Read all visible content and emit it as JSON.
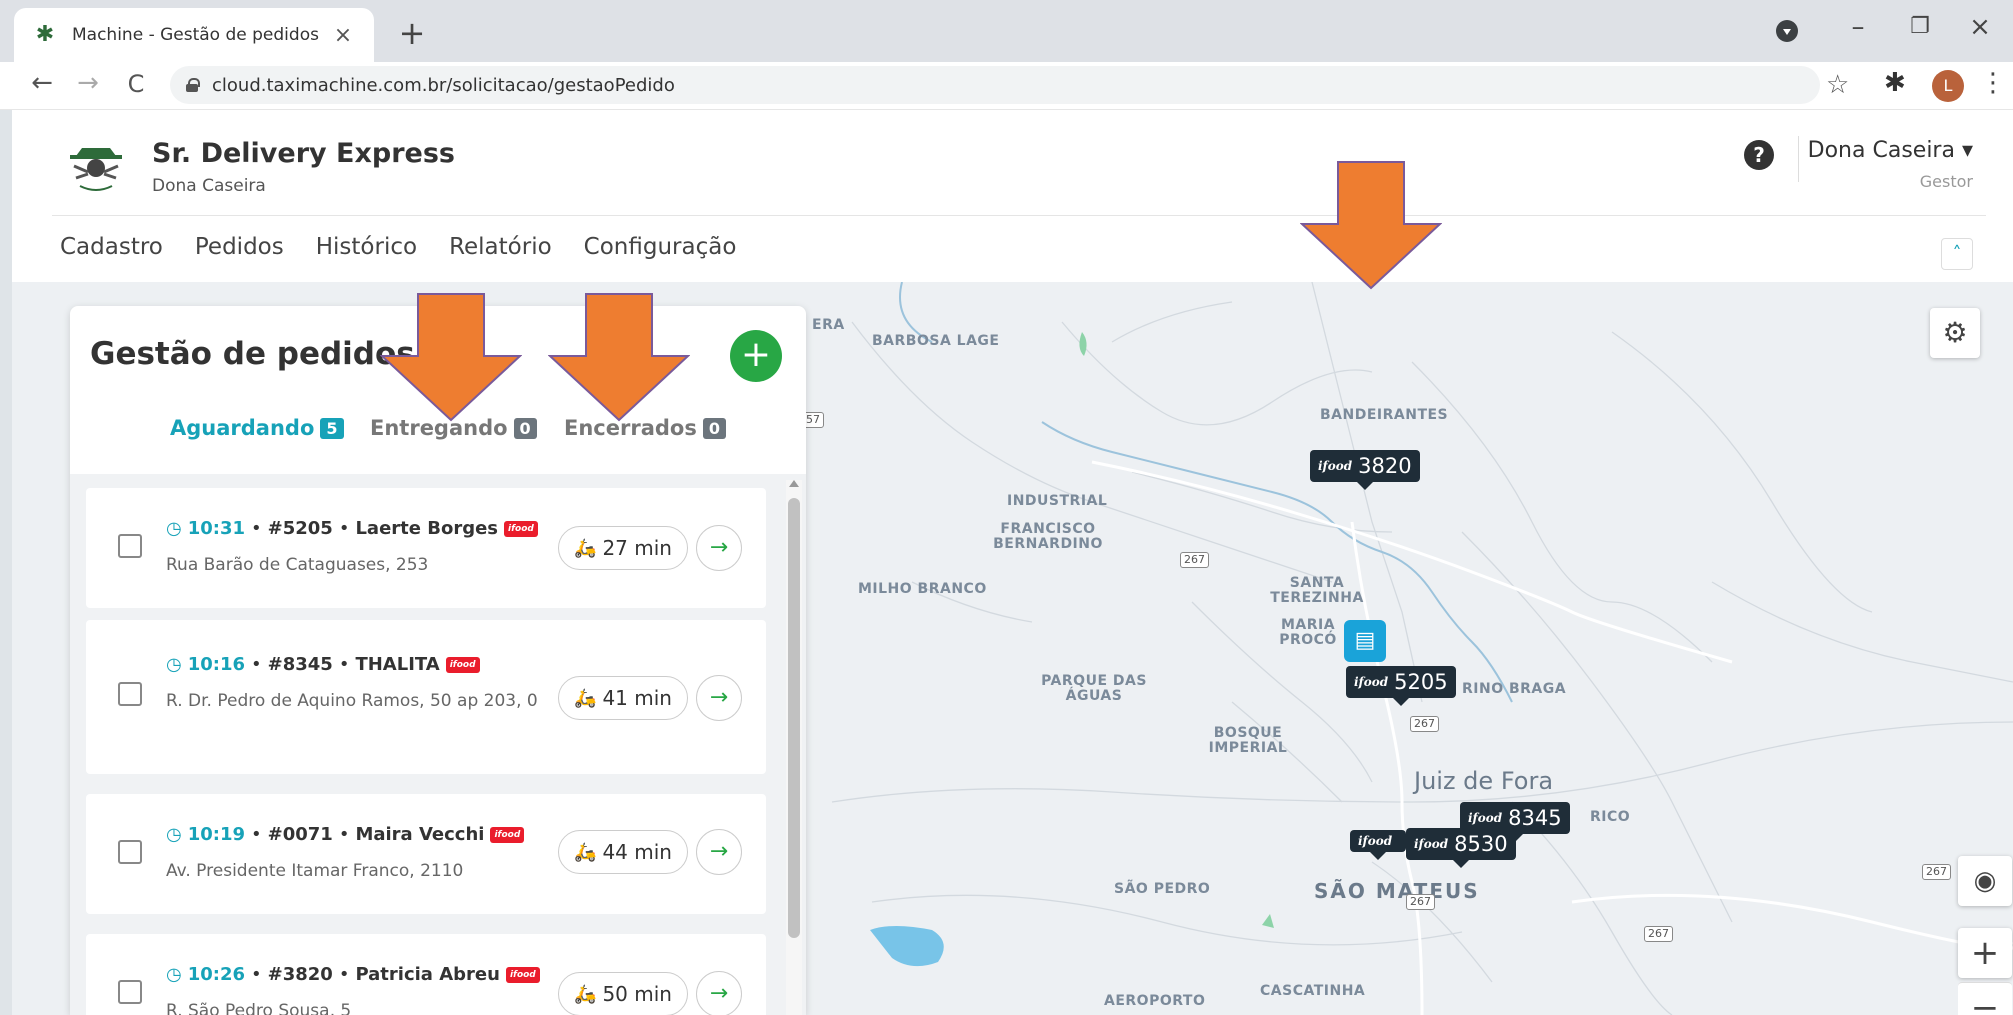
{
  "browser": {
    "tab_title": "Machine - Gestão de pedidos",
    "tab_close": "×",
    "new_tab": "+",
    "url": "cloud.taximachine.com.br/solicitacao/gestaoPedido",
    "profile_initial": "L",
    "back": "←",
    "forward": "→",
    "reload": "C",
    "star": "☆",
    "extensions": "✱",
    "menu": "⋮",
    "minimize": "–",
    "restore": "❐",
    "close": "×"
  },
  "header": {
    "brand_name": "Sr. Delivery Express",
    "brand_sub": "Dona Caseira",
    "help": "?",
    "user_name": "Dona Caseira ▾",
    "user_role": "Gestor",
    "collapse": "˄",
    "nav": [
      "Cadastro",
      "Pedidos",
      "Histórico",
      "Relatório",
      "Configuração"
    ]
  },
  "panel": {
    "title": "Gestão de pedidos",
    "add": "+",
    "tabs": [
      {
        "label": "Aguardando",
        "count": "5"
      },
      {
        "label": "Entregando",
        "count": "0"
      },
      {
        "label": "Encerrados",
        "count": "0"
      }
    ],
    "orders": [
      {
        "time": "10:31",
        "code": "#5205",
        "name": "Laerte Borges",
        "address": "Rua Barão de Cataguases, 253",
        "eta": "27 min"
      },
      {
        "time": "10:16",
        "code": "#8345",
        "name": "THALITA",
        "address": "R. Dr. Pedro de Aquino Ramos, 50 ap 203, 0",
        "eta": "41 min"
      },
      {
        "time": "10:19",
        "code": "#0071",
        "name": "Maira Vecchi",
        "address": "Av. Presidente Itamar Franco, 2110",
        "eta": "44 min"
      },
      {
        "time": "10:26",
        "code": "#3820",
        "name": "Patricia Abreu",
        "address": "R. São Pedro Sousa, 5",
        "eta": "50 min"
      }
    ],
    "sep": "•",
    "clock": "◷",
    "moto": "🛵",
    "go": "→",
    "ifood_badge": "ifood"
  },
  "map": {
    "labels": {
      "barbosa_lage": "BARBOSA LAGE",
      "bandeirantes": "BANDEIRANTES",
      "industrial": "INDUSTRIAL",
      "francisco_bernardino": "FRANCISCO BERNARDINO",
      "milho_branco": "MILHO BRANCO",
      "santa_terezinha": "SANTA TEREZINHA",
      "maria_proco": "MARIA PROCÓ",
      "parque_das_aguas": "PARQUE DAS ÁGUAS",
      "rino_braga": "RINO BRAGA",
      "bosque_imperial": "BOSQUE IMPERIAL",
      "juiz_de_fora": "Juiz de Fora",
      "rico": "RICO",
      "sao_pedro": "SÃO PEDRO",
      "sao_mateus": "SÃO MATEUS",
      "cascatinha": "CASCATINHA",
      "aeroporto": "AEROPORTO",
      "era": "ERA"
    },
    "road_shields": [
      "267",
      "267",
      "267",
      "267",
      "267",
      "57"
    ],
    "pins": [
      {
        "logo": "ifood",
        "number": "3820"
      },
      {
        "logo": "ifood",
        "number": "5205"
      },
      {
        "logo": "ifood",
        "number": "8345"
      },
      {
        "logo": "ifood",
        "number": "8530"
      },
      {
        "logo": "ifood",
        "number": ""
      }
    ],
    "store_icon": "▤",
    "settings_icon": "⚙",
    "locate_icon": "◉",
    "zoom_in": "+",
    "zoom_out": "−"
  },
  "colors": {
    "accent": "#17a2b8",
    "success": "#28a745",
    "arrow": "#ee7d30",
    "pin": "#1f2d38",
    "ifood": "#ea1d2c"
  }
}
